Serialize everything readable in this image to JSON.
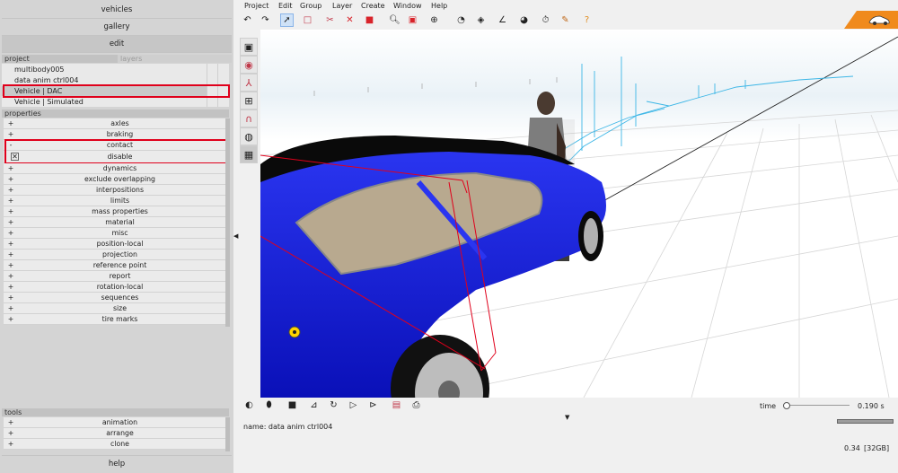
{
  "nav": {
    "vehicles": "vehicles",
    "gallery": "gallery",
    "edit": "edit",
    "help": "help"
  },
  "project": {
    "header": "project",
    "layers_label": "layers",
    "items": [
      "multibody005",
      "data anim ctrl004",
      "Vehicle | DAC",
      "Vehicle | Simulated"
    ]
  },
  "properties": {
    "header": "properties",
    "rows": [
      {
        "sign": "+",
        "label": "axles"
      },
      {
        "sign": "+",
        "label": "braking"
      },
      {
        "sign": "-",
        "label": "contact"
      },
      {
        "sign": "",
        "label": "disable"
      },
      {
        "sign": "+",
        "label": "dynamics"
      },
      {
        "sign": "+",
        "label": "exclude overlapping"
      },
      {
        "sign": "+",
        "label": "interpositions"
      },
      {
        "sign": "+",
        "label": "limits"
      },
      {
        "sign": "+",
        "label": "mass properties"
      },
      {
        "sign": "+",
        "label": "material"
      },
      {
        "sign": "+",
        "label": "misc"
      },
      {
        "sign": "+",
        "label": "position-local"
      },
      {
        "sign": "+",
        "label": "projection"
      },
      {
        "sign": "+",
        "label": "reference point"
      },
      {
        "sign": "+",
        "label": "report"
      },
      {
        "sign": "+",
        "label": "rotation-local"
      },
      {
        "sign": "+",
        "label": "sequences"
      },
      {
        "sign": "+",
        "label": "size"
      },
      {
        "sign": "+",
        "label": "tire marks"
      }
    ]
  },
  "tools": {
    "header": "tools",
    "rows": [
      {
        "sign": "+",
        "label": "animation"
      },
      {
        "sign": "+",
        "label": "arrange"
      },
      {
        "sign": "+",
        "label": "clone"
      }
    ]
  },
  "menu": [
    "Project",
    "Edit",
    "Group",
    "Layer",
    "Create",
    "Window",
    "Help"
  ],
  "toolbar_icons": [
    "undo-icon",
    "redo-icon",
    "select-arrow-icon",
    "rectangle-select-icon",
    "cut-scissors-icon",
    "delete-x-icon",
    "red-cube-icon",
    "red-square-icon",
    "zoom-icon",
    "red-box-icon",
    "target-icon",
    "dial-icon",
    "diamond-icon",
    "angle-icon",
    "gauge-icon",
    "stopwatch-icon",
    "pencil-icon",
    "help-icon"
  ],
  "vertical_tools": [
    "grid-view-icon",
    "record-icon",
    "vector-icon",
    "vehicle-icon",
    "magnet-icon",
    "color-icon",
    "grid-icon"
  ],
  "bottom_icons": [
    "sphere-icon",
    "tire-icon",
    "black-square-icon",
    "chart-icon",
    "refresh-icon",
    "play-icon",
    "step-icon",
    "notes-icon",
    "print-icon"
  ],
  "status": {
    "name_line": "name: data anim ctrl004",
    "time_label": "time",
    "time_value": "0.190 s",
    "memory": "0.34",
    "memory_total": "[32GB]"
  },
  "colors": {
    "car": "#0f17d8",
    "highlight": "#e0001b",
    "accent": "#f08a1c"
  }
}
